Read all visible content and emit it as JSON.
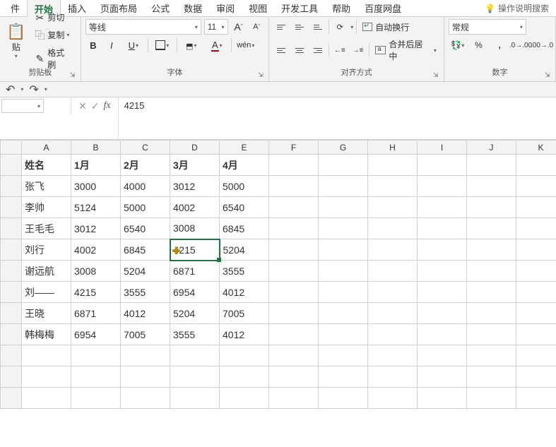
{
  "tabs": [
    "件",
    "开始",
    "插入",
    "页面布局",
    "公式",
    "数据",
    "审阅",
    "视图",
    "开发工具",
    "帮助",
    "百度网盘"
  ],
  "active_tab": "开始",
  "tellme_placeholder": "操作说明搜索",
  "clipboard": {
    "cut": "剪切",
    "copy": "复制",
    "format_painter": "格式刷",
    "paste": "贴",
    "group_label": "剪贴板"
  },
  "font": {
    "name": "等线",
    "size": "11",
    "ruby": "wén",
    "group_label": "字体"
  },
  "alignment": {
    "wrap": "自动换行",
    "merge": "合并后居中",
    "group_label": "对齐方式"
  },
  "number": {
    "format": "常规",
    "group_label": "数字"
  },
  "namebox": "",
  "formula_value": "4215",
  "columns": [
    "A",
    "B",
    "C",
    "D",
    "E",
    "F",
    "G",
    "H",
    "I",
    "J",
    "K"
  ],
  "selected_cell": {
    "row": 5,
    "col": 3
  },
  "headers": [
    "姓名",
    "1月",
    "2月",
    "3月",
    "4月"
  ],
  "rows": [
    [
      "张飞",
      "3000",
      "4000",
      "3012",
      "5000"
    ],
    [
      "李帅",
      "5124",
      "5000",
      "4002",
      "6540"
    ],
    [
      "王毛毛",
      "3012",
      "6540",
      "3008",
      "6845"
    ],
    [
      "刘行",
      "4002",
      "6845",
      "4215",
      "5204"
    ],
    [
      "谢远航",
      "3008",
      "5204",
      "6871",
      "3555"
    ],
    [
      "刘——",
      "4215",
      "3555",
      "6954",
      "4012"
    ],
    [
      "王晓",
      "6871",
      "4012",
      "5204",
      "7005"
    ],
    [
      "韩梅梅",
      "6954",
      "7005",
      "3555",
      "4012"
    ]
  ],
  "chart_data": {
    "type": "table",
    "columns": [
      "姓名",
      "1月",
      "2月",
      "3月",
      "4月"
    ],
    "rows": [
      [
        "张飞",
        3000,
        4000,
        3012,
        5000
      ],
      [
        "李帅",
        5124,
        5000,
        4002,
        6540
      ],
      [
        "王毛毛",
        3012,
        6540,
        3008,
        6845
      ],
      [
        "刘行",
        4002,
        6845,
        4215,
        5204
      ],
      [
        "谢远航",
        3008,
        5204,
        6871,
        3555
      ],
      [
        "刘——",
        4215,
        3555,
        6954,
        4012
      ],
      [
        "王晓",
        6871,
        4012,
        5204,
        7005
      ],
      [
        "韩梅梅",
        6954,
        7005,
        3555,
        4012
      ]
    ]
  }
}
